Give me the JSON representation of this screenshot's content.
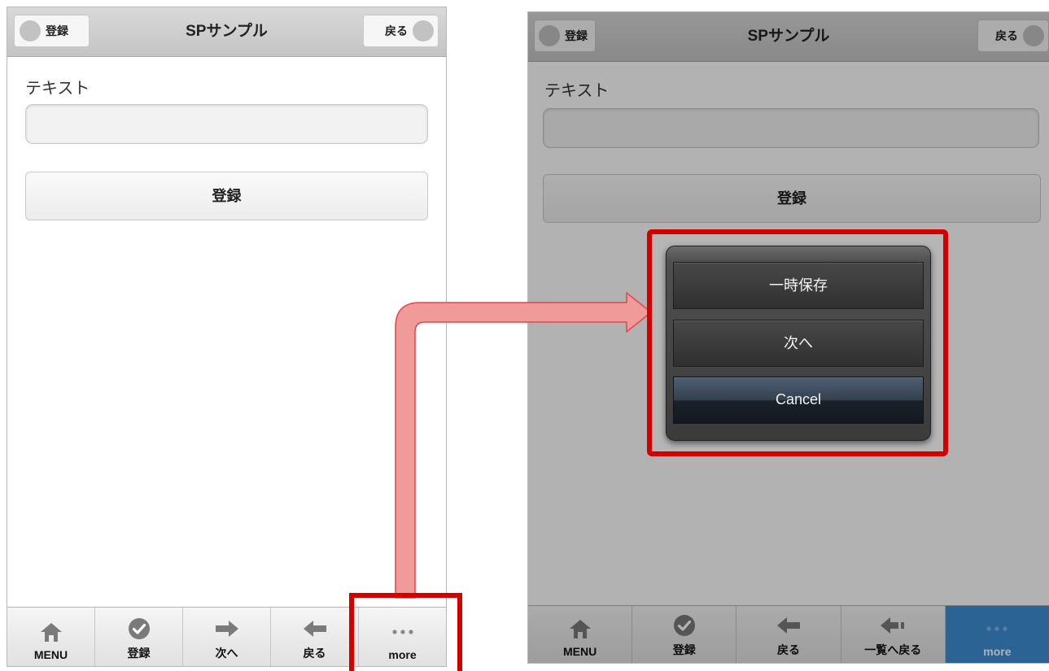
{
  "left_screen": {
    "header": {
      "title": "SPサンプル",
      "left_button": "登録",
      "right_button": "戻る"
    },
    "field_label": "テキスト",
    "text_value": "",
    "submit_button": "登録",
    "toolbar": [
      {
        "label": "MENU",
        "icon": "home-icon"
      },
      {
        "label": "登録",
        "icon": "check-circle-icon"
      },
      {
        "label": "次へ",
        "icon": "arrow-right-icon"
      },
      {
        "label": "戻る",
        "icon": "arrow-left-icon"
      },
      {
        "label": "more",
        "icon": "ellipsis-icon"
      }
    ]
  },
  "right_screen": {
    "header": {
      "title": "SPサンプル",
      "left_button": "登録",
      "right_button": "戻る"
    },
    "field_label": "テキスト",
    "text_value": "",
    "submit_button": "登録",
    "action_sheet": {
      "items": [
        "一時保存",
        "次へ"
      ],
      "cancel": "Cancel"
    },
    "toolbar": [
      {
        "label": "MENU",
        "icon": "home-icon"
      },
      {
        "label": "登録",
        "icon": "check-circle-icon"
      },
      {
        "label": "戻る",
        "icon": "arrow-left-icon"
      },
      {
        "label": "一覧へ戻る",
        "icon": "arrow-left-list-icon"
      },
      {
        "label": "more",
        "icon": "ellipsis-icon",
        "active": true
      }
    ]
  },
  "colors": {
    "highlight": "#d40000",
    "callout_arrow_fill": "#f19a9a",
    "active_tab": "#3f8fd6",
    "header": "#cccccc"
  }
}
